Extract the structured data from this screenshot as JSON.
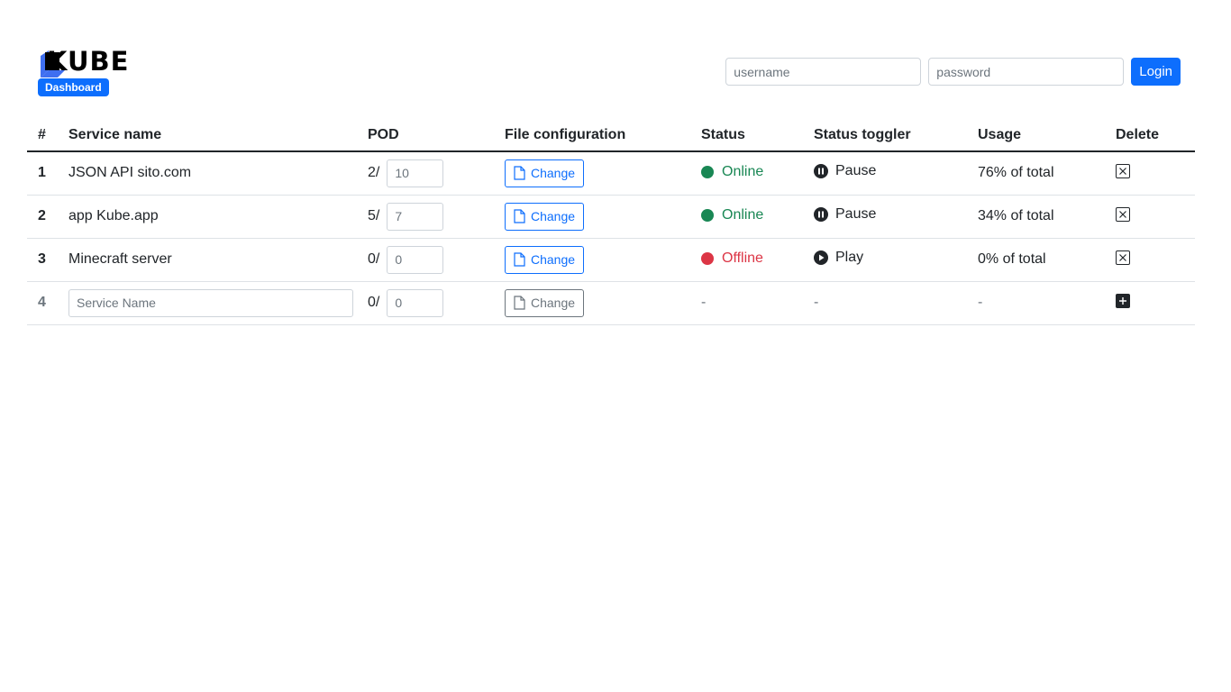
{
  "brand": {
    "name": "KUBE",
    "badge": "Dashboard",
    "accent": "#0d6efd"
  },
  "login": {
    "username_placeholder": "username",
    "password_placeholder": "password",
    "button_label": "Login"
  },
  "table": {
    "headers": [
      "#",
      "Service name",
      "POD",
      "File configuration",
      "Status",
      "Status toggler",
      "Usage",
      "Delete"
    ],
    "rows": [
      {
        "num": "1",
        "service": "JSON API sito.com",
        "pod_current": "2/",
        "pod_value": "10",
        "change": "Change",
        "status": "Online",
        "status_color": "#198754",
        "toggle": "Pause",
        "toggle_icon": "pause-icon",
        "usage": "76% of total"
      },
      {
        "num": "2",
        "service": "app Kube.app",
        "pod_current": "5/",
        "pod_value": "7",
        "change": "Change",
        "status": "Online",
        "status_color": "#198754",
        "toggle": "Pause",
        "toggle_icon": "pause-icon",
        "usage": "34% of total"
      },
      {
        "num": "3",
        "service": "Minecraft server",
        "pod_current": "0/",
        "pod_value": "0",
        "change": "Change",
        "status": "Offline",
        "status_color": "#dc3545",
        "toggle": "Play",
        "toggle_icon": "play-icon",
        "usage": "0% of total"
      }
    ],
    "new_row": {
      "num": "4",
      "service_placeholder": "Service Name",
      "pod_current": "0/",
      "pod_placeholder": "0",
      "change": "Change",
      "status": "-",
      "toggle": "-",
      "usage": "-"
    }
  }
}
